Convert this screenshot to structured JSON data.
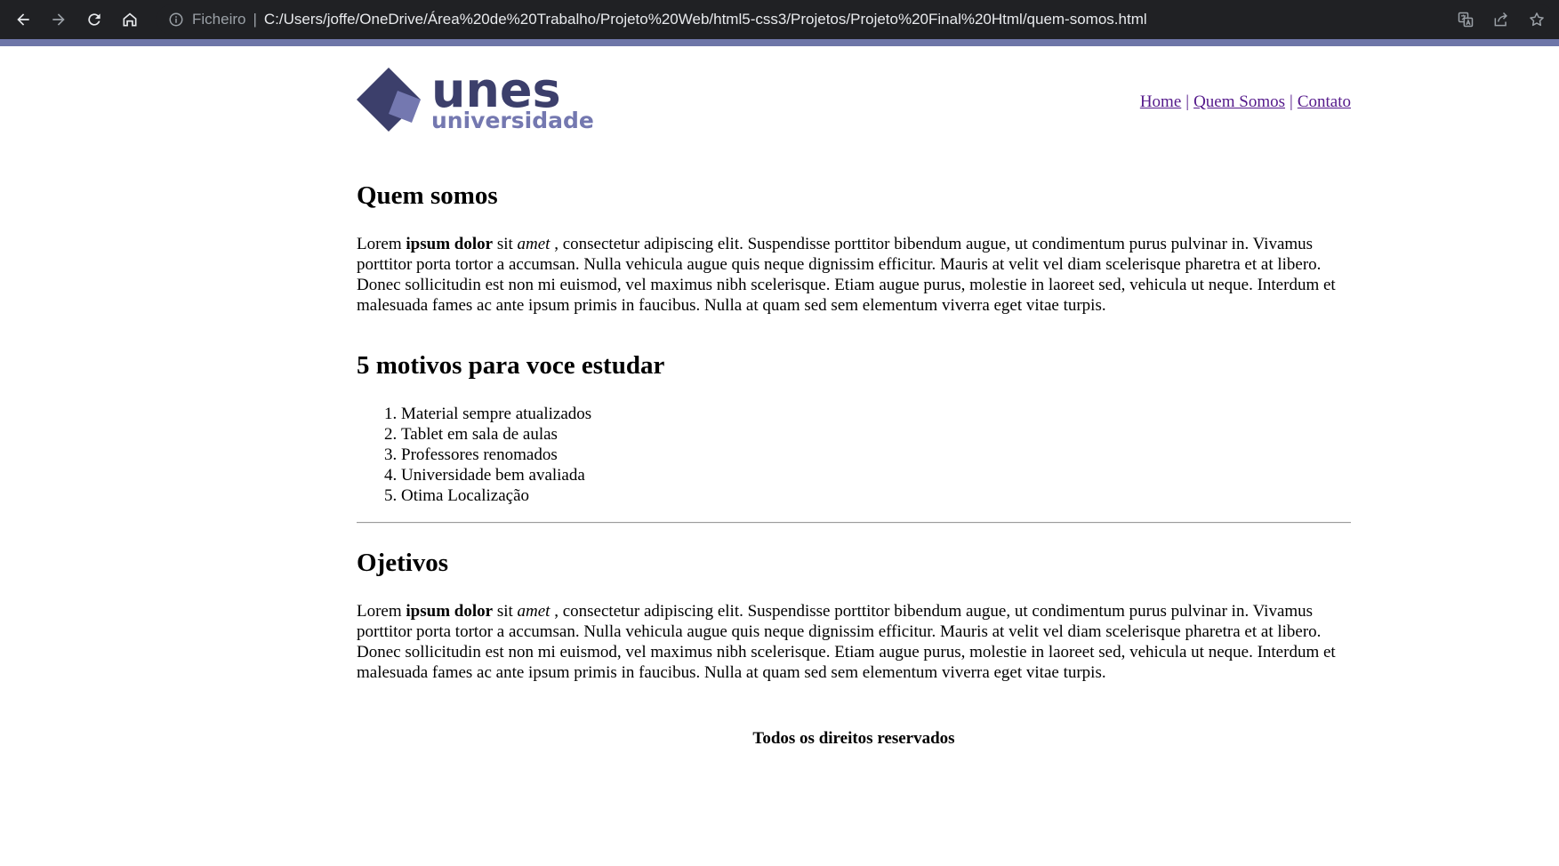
{
  "browser": {
    "back_icon": "arrow-left-icon",
    "forward_icon": "arrow-right-icon",
    "reload_icon": "reload-icon",
    "home_icon": "home-icon",
    "scheme_label": "Ficheiro",
    "separator": "|",
    "url": "C:/Users/joffe/OneDrive/Área%20de%20Trabalho/Projeto%20Web/html5-css3/Projetos/Projeto%20Final%20Html/quem-somos.html",
    "accent_color": "#6e76a8"
  },
  "header": {
    "logo": {
      "word_main": "unes",
      "word_sub": "universidade",
      "color_dark": "#3c3f6b",
      "color_light": "#7478b0"
    },
    "nav": [
      {
        "label": "Home"
      },
      {
        "label": "Quem Somos"
      },
      {
        "label": "Contato"
      }
    ],
    "nav_separator": "|"
  },
  "sections": {
    "about": {
      "title": "Quem somos",
      "p_start": "Lorem ",
      "p_bold": "ipsum dolor",
      "p_mid": " sit ",
      "p_italic": "amet",
      "p_end": " , consectetur adipiscing elit. Suspendisse porttitor bibendum augue, ut condimentum purus pulvinar in. Vivamus porttitor porta tortor a accumsan. Nulla vehicula augue quis neque dignissim efficitur. Mauris at velit vel diam scelerisque pharetra et at libero. Donec sollicitudin est non mi euismod, vel maximus nibh scelerisque. Etiam augue purus, molestie in laoreet sed, vehicula ut neque. Interdum et malesuada fames ac ante ipsum primis in faucibus. Nulla at quam sed sem elementum viverra eget vitae turpis."
    },
    "reasons": {
      "title": "5 motivos para voce estudar",
      "items": [
        "Material sempre atualizados",
        "Tablet em sala de aulas",
        "Professores renomados",
        "Universidade bem avaliada",
        "Otima Localização"
      ]
    },
    "goals": {
      "title": "Ojetivos",
      "p_start": "Lorem ",
      "p_bold": "ipsum dolor",
      "p_mid": " sit ",
      "p_italic": "amet",
      "p_end": " , consectetur adipiscing elit. Suspendisse porttitor bibendum augue, ut condimentum purus pulvinar in. Vivamus porttitor porta tortor a accumsan. Nulla vehicula augue quis neque dignissim efficitur. Mauris at velit vel diam scelerisque pharetra et at libero. Donec sollicitudin est non mi euismod, vel maximus nibh scelerisque. Etiam augue purus, molestie in laoreet sed, vehicula ut neque. Interdum et malesuada fames ac ante ipsum primis in faucibus. Nulla at quam sed sem elementum viverra eget vitae turpis."
    }
  },
  "footer": {
    "text": "Todos os direitos reservados"
  }
}
